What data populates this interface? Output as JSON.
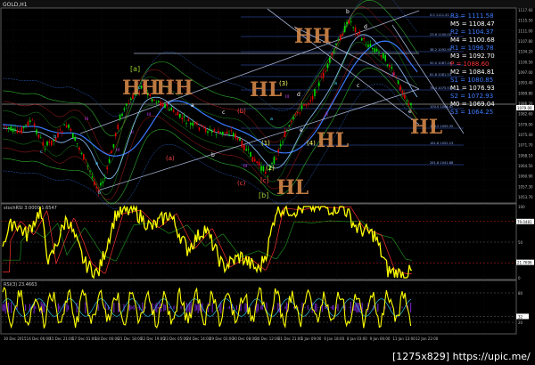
{
  "window_title": "GOLD,H1",
  "watermark": "[1275x829] https://upic.me/",
  "price_axis": {
    "labels": [
      "1117.60",
      "1115.50",
      "1111.00",
      "1107.80",
      "1104.20",
      "1100.50",
      "1097.00",
      "1093.40",
      "1089.80",
      "1086.20",
      "1082.60",
      "1079.00",
      "1075.40",
      "1071.70",
      "1068.10",
      "1064.50",
      "1060.90",
      "1057.30",
      "1053.70"
    ]
  },
  "levels_panel": [
    {
      "label": "R3 = 1111.58",
      "color": "#3a7bff"
    },
    {
      "label": "M5 = 1108.47",
      "color": "#ffffff"
    },
    {
      "label": "R2 = 1104.37",
      "color": "#3a7bff"
    },
    {
      "label": "M4 = 1100.68",
      "color": "#ffffff"
    },
    {
      "label": "R1 = 1096.78",
      "color": "#3a7bff"
    },
    {
      "label": "M3 = 1092.70",
      "color": "#ffffff"
    },
    {
      "label": "P = 1088.60",
      "color": "#ff3333"
    },
    {
      "label": "M2 = 1084.81",
      "color": "#ffffff"
    },
    {
      "label": "S1 = 1080.85",
      "color": "#3a7bff"
    },
    {
      "label": "M1 = 1076.93",
      "color": "#ffffff"
    },
    {
      "label": "S2 = 1072.93",
      "color": "#3a7bff"
    },
    {
      "label": "M0 = 1069.04",
      "color": "#ffffff"
    },
    {
      "label": "S3 = 1064.25",
      "color": "#3a7bff"
    }
  ],
  "fib_labels": [
    "0.0 1111.51",
    "23.6 1100.00",
    "38.2 1092.95",
    "50.0 1087.24",
    "61.8 1081.53",
    "76.4 1075.53",
    "100.0 1064.47",
    "138.2 1059.35",
    "161.8 1052.23",
    "261.8 1041.88"
  ],
  "wave_labels": [
    {
      "text": "[a]",
      "color": "#9acd32"
    },
    {
      "text": "[b]",
      "color": "#9acd32"
    },
    {
      "text": "[c]",
      "color": "#ff4444"
    },
    {
      "text": "(a)",
      "color": "#ff4444"
    },
    {
      "text": "(b)",
      "color": "#ff4444"
    },
    {
      "text": "(c)",
      "color": "#ff4444"
    },
    {
      "text": "a",
      "color": "#ffffff"
    },
    {
      "text": "b",
      "color": "#ffffff"
    },
    {
      "text": "c",
      "color": "#ffffff"
    },
    {
      "text": "d",
      "color": "#ffffff"
    },
    {
      "text": "e",
      "color": "#ffffff"
    },
    {
      "text": "(1)",
      "color": "#ffff66"
    },
    {
      "text": "(2)",
      "color": "#ffff66"
    },
    {
      "text": "(3)",
      "color": "#ffff66"
    },
    {
      "text": "(4)",
      "color": "#ffff66"
    },
    {
      "text": "b",
      "color": "#ffffff"
    },
    {
      "text": "d",
      "color": "#ffffff"
    },
    {
      "text": "c",
      "color": "#ffffff"
    },
    {
      "text": "e",
      "color": "#ffffff"
    }
  ],
  "handwritten_marks": [
    "HH",
    "HH",
    "HH",
    "HL",
    "HL",
    "HL"
  ],
  "stoch_panel": {
    "title": "stochRSI 3.0000 1.6547",
    "axis_labels": [
      "100",
      "79.0481",
      "50",
      "21.7696",
      "0"
    ],
    "value_tags": [
      "79.0481",
      "21.7696"
    ]
  },
  "rsi_panel": {
    "title": "RSI(3) 23.4663",
    "axis_labels": [
      "80",
      "32",
      "20"
    ],
    "value_tag": "32"
  },
  "time_axis": {
    "labels": [
      "30 Dec 2015",
      "14 Dec 06:00",
      "15 Dec 21:00",
      "17 Dec 01:00",
      "18 Dec 06:00",
      "21 Dec 18:00",
      "22 Dec 19:00",
      "23 Dec 05:00",
      "24 Dec 14:00",
      "29 Dec 03:00",
      "30 Dec 08:00",
      "30 Dec 12:00",
      "31 Dec 21:00",
      "5 Jan 09:00",
      "6 Jan 18:00",
      "8 Jan 03:00",
      "9 Jan 06:00",
      "11 Jan 13:00",
      "12 Jan 22:00"
    ]
  },
  "colors": {
    "background": "#000000",
    "grid": "#1a1a1a",
    "bull_candle": "#00e000",
    "bear_candle": "#e00000",
    "ma_blue": "#3b7bff",
    "ma_lightblue": "#8ec9ff",
    "env_green": "#2fb02f",
    "env_red": "#b02020",
    "stoch_main": "#ffff00",
    "stoch_signal": "#ff3030",
    "rsi_main": "#ffff00",
    "rsi_fill": "#7a2ad0",
    "handwritten": "#d98a4a",
    "trendline": "#c8d8ff"
  }
}
